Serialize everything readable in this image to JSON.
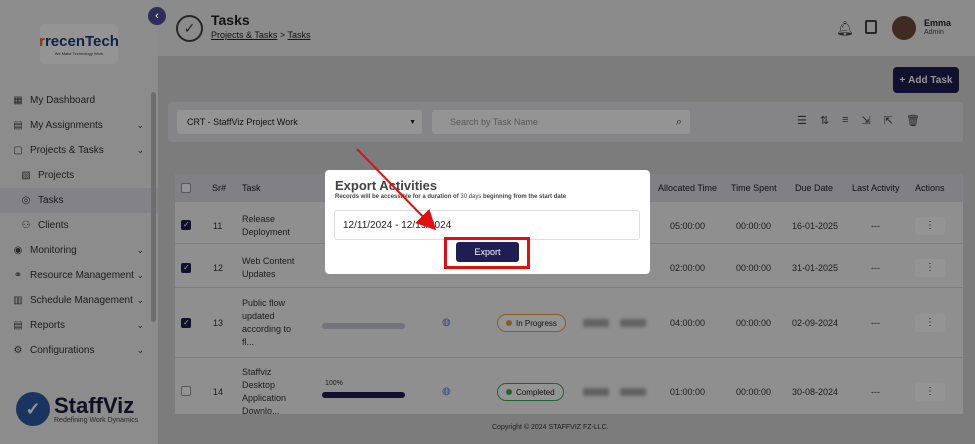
{
  "sidebar": {
    "logo": {
      "main": "recenTech",
      "sub": "We Make Technology Work"
    },
    "items": [
      {
        "label": "My Dashboard",
        "icon": "dashboard-icon",
        "chevron": false
      },
      {
        "label": "My Assignments",
        "icon": "assignments-icon",
        "chevron": true
      },
      {
        "label": "Projects & Tasks",
        "icon": "clipboard-icon",
        "chevron": true
      },
      {
        "label": "Projects",
        "icon": "projects-icon",
        "chevron": false,
        "sub": true
      },
      {
        "label": "Tasks",
        "icon": "check-circle-icon",
        "chevron": false,
        "sub": true,
        "active": true
      },
      {
        "label": "Clients",
        "icon": "clients-icon",
        "chevron": false,
        "sub": true
      },
      {
        "label": "Monitoring",
        "icon": "monitor-icon",
        "chevron": true
      },
      {
        "label": "Resource Management",
        "icon": "resource-icon",
        "chevron": true
      },
      {
        "label": "Schedule Management",
        "icon": "schedule-icon",
        "chevron": true
      },
      {
        "label": "Reports",
        "icon": "reports-icon",
        "chevron": true
      },
      {
        "label": "Configurations",
        "icon": "gear-icon",
        "chevron": true
      }
    ],
    "brand": {
      "name": "StaffViz",
      "tagline": "Redefining Work Dynamics"
    }
  },
  "header": {
    "title": "Tasks",
    "breadcrumb": [
      "Projects & Tasks",
      "Tasks"
    ],
    "breadcrumb_sep": ">",
    "user": {
      "name": "Emma",
      "role": "Admin"
    }
  },
  "toolbar": {
    "add_task_label": "Add Task",
    "project_select": "CRT - StaffViz Project Work",
    "search_placeholder": "Search by Task Name"
  },
  "table": {
    "headers": [
      "Sr#",
      "Task",
      "Allocated Time",
      "Time Spent",
      "Due Date",
      "Last Activity",
      "Actions"
    ],
    "rows": [
      {
        "sr": "11",
        "task": "Release Deployment",
        "allocated": "05:00:00",
        "spent": "00:00:00",
        "due": "16-01-2025",
        "last": "---",
        "checked": true
      },
      {
        "sr": "12",
        "task": "Web Content Updates",
        "allocated": "02:00:00",
        "spent": "00:00:00",
        "due": "31-01-2025",
        "last": "---",
        "checked": true
      },
      {
        "sr": "13",
        "task": "Public flow updated according to fl...",
        "allocated": "04:00:00",
        "spent": "00:00:00",
        "due": "02-09-2024",
        "last": "---",
        "checked": true,
        "status": "In Progress",
        "status_color": "#e8a13a",
        "progress": 0
      },
      {
        "sr": "14",
        "task": "Staffviz Desktop Application Downlo...",
        "allocated": "01:00:00",
        "spent": "00:00:00",
        "due": "30-08-2024",
        "last": "---",
        "checked": false,
        "status": "Completed",
        "status_color": "#3aa84f",
        "progress": 100,
        "progress_label": "100%"
      }
    ]
  },
  "modal": {
    "title": "Export Activities",
    "note_start": "Records will be accessible for a duration of ",
    "note_days": "30 days",
    "note_end": " beginning from the start date",
    "date_range": "12/11/2024 - 12/19/2024",
    "export_label": "Export"
  },
  "footer": {
    "copyright": "Copyright © 2024 STAFFVIZ FZ-LLC."
  },
  "colors": {
    "primary": "#1e1e52",
    "highlight": "#e01010"
  }
}
